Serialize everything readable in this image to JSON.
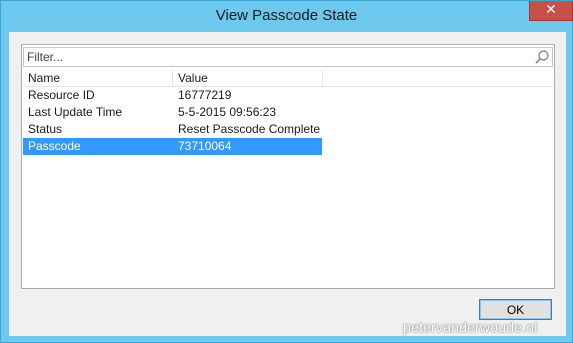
{
  "window": {
    "title": "View Passcode State"
  },
  "filter": {
    "placeholder": "Filter..."
  },
  "grid": {
    "columns": [
      "Name",
      "Value"
    ],
    "rows": [
      {
        "name": "Resource ID",
        "value": "16777219"
      },
      {
        "name": "Last Update Time",
        "value": "5-5-2015 09:56:23"
      },
      {
        "name": "Status",
        "value": "Reset Passcode Complete"
      },
      {
        "name": "Passcode",
        "value": "73710064",
        "selected": true
      }
    ]
  },
  "buttons": {
    "ok": "OK",
    "close": "✕"
  },
  "watermark": "petervanderwoude.nl",
  "colors": {
    "frame": "#6cc8ec",
    "selection": "#3399ff",
    "close": "#c7504a"
  }
}
